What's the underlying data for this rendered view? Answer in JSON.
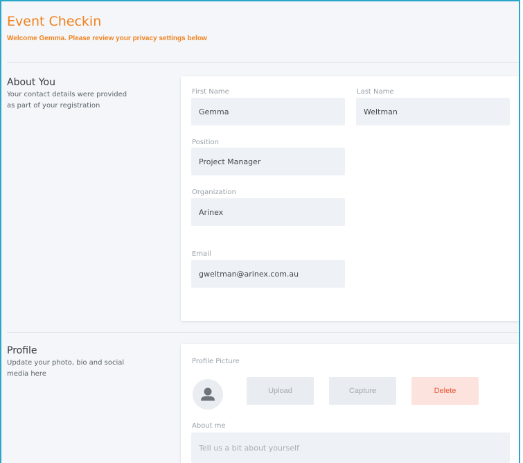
{
  "header": {
    "title": "Event Checkin",
    "subtitle": "Welcome Gemma. Please review your privacy settings below"
  },
  "about": {
    "title": "About You",
    "description": "Your contact details were provided as part of your registration",
    "fields": {
      "first_name": {
        "label": "First Name",
        "value": "Gemma"
      },
      "last_name": {
        "label": "Last Name",
        "value": "Weltman"
      },
      "position": {
        "label": "Position",
        "value": "Project Manager"
      },
      "organization": {
        "label": "Organization",
        "value": "Arinex"
      },
      "email": {
        "label": "Email",
        "value": "gweltman@arinex.com.au"
      }
    }
  },
  "profile": {
    "title": "Profile",
    "description": "Update your photo, bio and social media here",
    "picture_label": "Profile Picture",
    "upload_label": "Upload",
    "capture_label": "Capture",
    "delete_label": "Delete",
    "about_me_label": "About me",
    "about_me_placeholder": "Tell us a bit about yourself"
  },
  "colors": {
    "accent": "#f0821e",
    "frame_border": "#2aa6c9",
    "danger": "#e8553a"
  }
}
